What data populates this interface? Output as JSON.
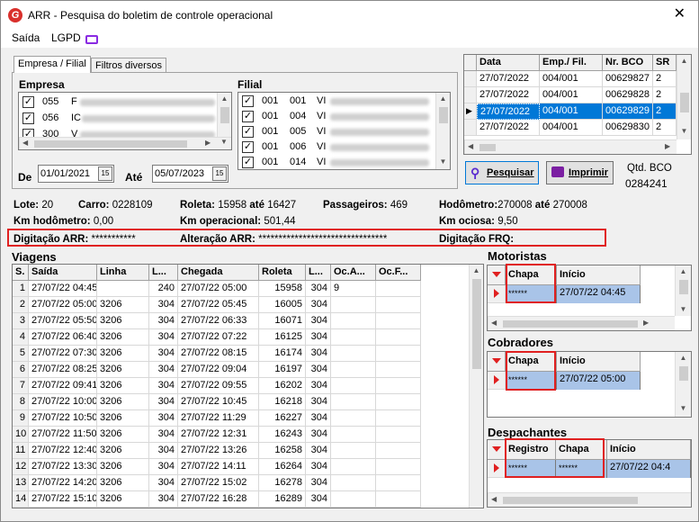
{
  "window": {
    "title": "ARR - Pesquisa do boletim de controle operacional",
    "close": "✕",
    "app_icon_letter": "G"
  },
  "menu": {
    "saida": "Saída",
    "lgpd": "LGPD"
  },
  "tabs": {
    "empresa_filial": "Empresa / Filial",
    "filtros": "Filtros diversos"
  },
  "empresa": {
    "label": "Empresa",
    "items": [
      {
        "code": "055",
        "name": "F"
      },
      {
        "code": "056",
        "name": "IC"
      },
      {
        "code": "300",
        "name": "V"
      }
    ],
    "check": "✓"
  },
  "filial": {
    "label": "Filial",
    "items": [
      {
        "emp": "001",
        "fil": "001",
        "name": "VI"
      },
      {
        "emp": "001",
        "fil": "004",
        "name": "VI"
      },
      {
        "emp": "001",
        "fil": "005",
        "name": "VI"
      },
      {
        "emp": "001",
        "fil": "006",
        "name": "VI"
      },
      {
        "emp": "001",
        "fil": "014",
        "name": "VI"
      }
    ]
  },
  "dates": {
    "de_label": "De",
    "de_value": "01/01/2021",
    "ate_label": "Até",
    "ate_value": "05/07/2023",
    "cal": "15"
  },
  "bco_grid": {
    "headers": [
      "Data",
      "Emp./ Fil.",
      "Nr. BCO",
      "SR"
    ],
    "rows": [
      {
        "data": "27/07/2022",
        "empfil": "004/001",
        "nr": "00629827",
        "sr": "2"
      },
      {
        "data": "27/07/2022",
        "empfil": "004/001",
        "nr": "00629828",
        "sr": "2"
      },
      {
        "data": "27/07/2022",
        "empfil": "004/001",
        "nr": "00629829",
        "sr": "2"
      },
      {
        "data": "27/07/2022",
        "empfil": "004/001",
        "nr": "00629830",
        "sr": "2"
      }
    ],
    "pointer": "▶"
  },
  "buttons": {
    "pesquisar": "Pesquisar",
    "imprimir": "Imprimir"
  },
  "qtd": {
    "label": "Qtd. BCO",
    "value": "0284241"
  },
  "info": {
    "lote_label": "Lote:",
    "lote": "20",
    "carro_label": "Carro:",
    "carro": "0228109",
    "roleta_label": "Roleta:",
    "roleta_de": "15958",
    "ate": "até",
    "roleta_ate": "16427",
    "passageiros_label": "Passageiros:",
    "passageiros": "469",
    "hodometro_label": "Hodômetro:",
    "hod_de": "270008",
    "hod_ate": "270008",
    "km_hod_label": "Km hodômetro:",
    "km_hod": "0,00",
    "km_op_label": "Km operacional:",
    "km_op": "501,44",
    "km_oc_label": "Km ociosa:",
    "km_oc": "9,50",
    "dig_arr_label": "Digitação ARR:",
    "dig_arr": "***********",
    "alt_arr_label": "Alteração ARR:",
    "alt_arr": "********************************",
    "dig_frq_label": "Digitação FRQ:"
  },
  "viagens": {
    "label": "Viagens",
    "headers": [
      "S.",
      "Saída",
      "Linha",
      "L...",
      "Chegada",
      "Roleta",
      "L...",
      "Oc.A...",
      "Oc.F..."
    ],
    "rows": [
      [
        "1",
        "27/07/22 04:45",
        "",
        "240",
        "27/07/22 05:00",
        "15958",
        "304",
        "9",
        ""
      ],
      [
        "2",
        "27/07/22 05:00",
        "3206",
        "304",
        "27/07/22 05:45",
        "16005",
        "304",
        "",
        ""
      ],
      [
        "3",
        "27/07/22 05:50",
        "3206",
        "304",
        "27/07/22 06:33",
        "16071",
        "304",
        "",
        ""
      ],
      [
        "4",
        "27/07/22 06:40",
        "3206",
        "304",
        "27/07/22 07:22",
        "16125",
        "304",
        "",
        ""
      ],
      [
        "5",
        "27/07/22 07:30",
        "3206",
        "304",
        "27/07/22 08:15",
        "16174",
        "304",
        "",
        ""
      ],
      [
        "6",
        "27/07/22 08:25",
        "3206",
        "304",
        "27/07/22 09:04",
        "16197",
        "304",
        "",
        ""
      ],
      [
        "7",
        "27/07/22 09:41",
        "3206",
        "304",
        "27/07/22 09:55",
        "16202",
        "304",
        "",
        ""
      ],
      [
        "8",
        "27/07/22 10:00",
        "3206",
        "304",
        "27/07/22 10:45",
        "16218",
        "304",
        "",
        ""
      ],
      [
        "9",
        "27/07/22 10:50",
        "3206",
        "304",
        "27/07/22 11:29",
        "16227",
        "304",
        "",
        ""
      ],
      [
        "10",
        "27/07/22 11:50",
        "3206",
        "304",
        "27/07/22 12:31",
        "16243",
        "304",
        "",
        ""
      ],
      [
        "11",
        "27/07/22 12:40",
        "3206",
        "304",
        "27/07/22 13:26",
        "16258",
        "304",
        "",
        ""
      ],
      [
        "12",
        "27/07/22 13:30",
        "3206",
        "304",
        "27/07/22 14:11",
        "16264",
        "304",
        "",
        ""
      ],
      [
        "13",
        "27/07/22 14:20",
        "3206",
        "304",
        "27/07/22 15:02",
        "16278",
        "304",
        "",
        ""
      ],
      [
        "14",
        "27/07/22 15:10",
        "3206",
        "304",
        "27/07/22 16:28",
        "16289",
        "304",
        "",
        ""
      ]
    ]
  },
  "motoristas": {
    "label": "Motoristas",
    "h_chapa": "Chapa",
    "h_inicio": "Início",
    "chapa": "******",
    "inicio": "27/07/22 04:45"
  },
  "cobradores": {
    "label": "Cobradores",
    "h_chapa": "Chapa",
    "h_inicio": "Início",
    "chapa": "******",
    "inicio": "27/07/22 05:00"
  },
  "despachantes": {
    "label": "Despachantes",
    "h_registro": "Registro",
    "h_chapa": "Chapa",
    "h_inicio": "Início",
    "registro": "******",
    "chapa": "******",
    "inicio": "27/07/22 04:4"
  },
  "colors": {
    "accent": "#0078d7",
    "highlight_box": "#e02020",
    "selected_row": "#a9c4e8"
  }
}
